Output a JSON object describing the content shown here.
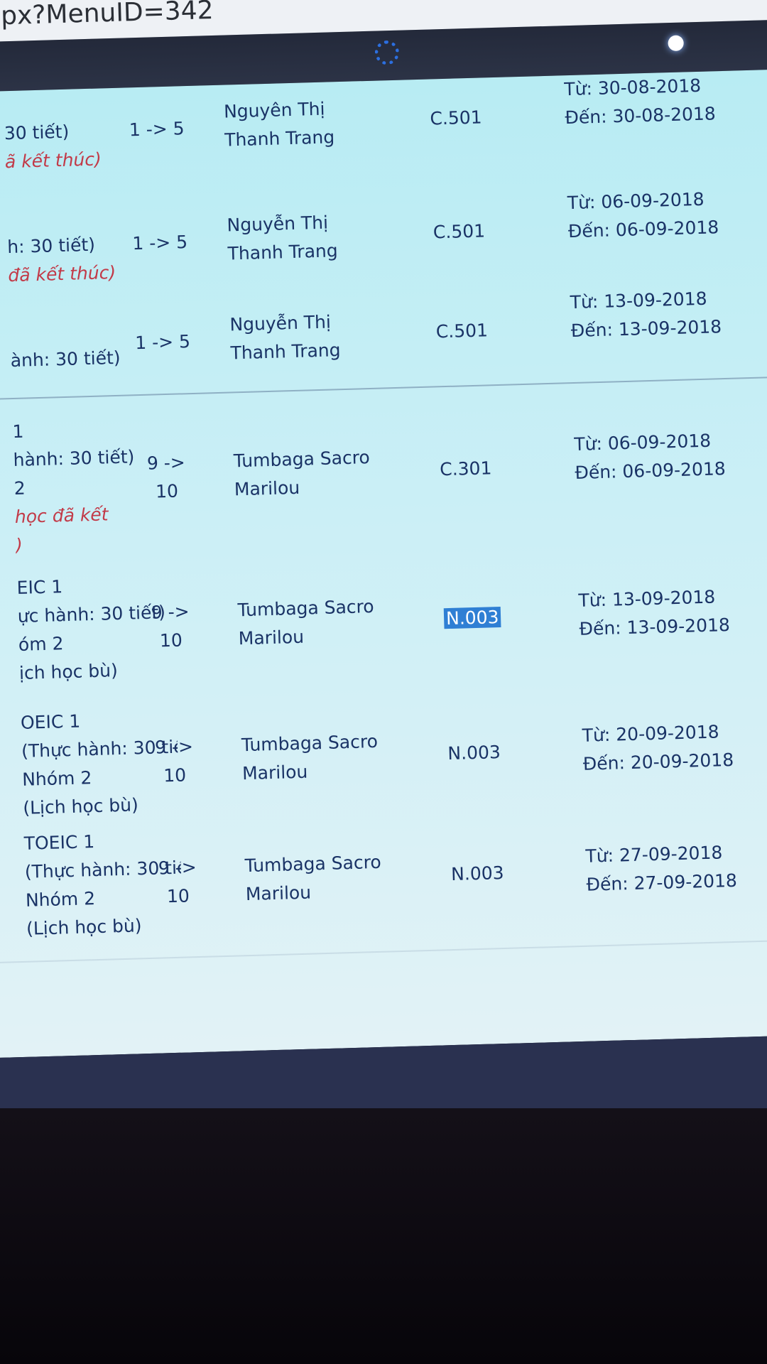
{
  "url": "px?MenuID=342",
  "rows": [
    {
      "subject": [
        "30 tiết)"
      ],
      "note": "ã kết thúc)",
      "period": [
        "1 -> 5"
      ],
      "teacher": [
        "Nguyên Thị",
        "Thanh Trang"
      ],
      "room": "C.501",
      "from": "Từ:   30-08-2018",
      "to": "Đến: 30-08-2018"
    },
    {
      "subject": [
        "h: 30 tiết)"
      ],
      "note": "đã kết thúc)",
      "period": [
        "1 -> 5"
      ],
      "teacher": [
        "Nguyễn Thị",
        "Thanh Trang"
      ],
      "room": "C.501",
      "from": "Từ:   06-09-2018",
      "to": "Đến: 06-09-2018"
    },
    {
      "subject": [
        "ành: 30 tiết)"
      ],
      "note": "",
      "period": [
        "1 -> 5"
      ],
      "teacher": [
        "Nguyễn Thị",
        "Thanh Trang"
      ],
      "room": "C.501",
      "from": "Từ:   13-09-2018",
      "to": "Đến: 13-09-2018"
    },
    {
      "subject": [
        "1",
        "hành: 30 tiết)",
        "2"
      ],
      "note": "học đã kết",
      "note2": ")",
      "period": [
        "9 ->",
        "10"
      ],
      "teacher": [
        "Tumbaga Sacro",
        "Marilou"
      ],
      "room": "C.301",
      "from": "Từ:   06-09-2018",
      "to": "Đến: 06-09-2018"
    },
    {
      "subject": [
        "EIC 1",
        "ực hành: 30 tiết)",
        "óm 2",
        "ịch học bù)"
      ],
      "note": "",
      "period": [
        "9 ->",
        "10"
      ],
      "teacher": [
        "Tumbaga Sacro",
        "Marilou"
      ],
      "room": "N.003",
      "room_highlight": true,
      "from": "Từ:   13-09-2018",
      "to": "Đến: 13-09-2018"
    },
    {
      "subject": [
        "OEIC 1",
        "(Thực hành: 30 tiết)",
        "Nhóm 2",
        "(Lịch học bù)"
      ],
      "note": "",
      "period": [
        "9 ->",
        "10"
      ],
      "teacher": [
        "Tumbaga Sacro",
        "Marilou"
      ],
      "room": "N.003",
      "from": "Từ:   20-09-2018",
      "to": "Đến: 20-09-2018"
    },
    {
      "subject": [
        "TOEIC 1",
        "(Thực hành: 30 tiết)",
        "Nhóm 2",
        "(Lịch học bù)"
      ],
      "note": "",
      "period": [
        "9 ->",
        "10"
      ],
      "teacher": [
        "Tumbaga Sacro",
        "Marilou"
      ],
      "room": "N.003",
      "from": "Từ:   27-09-2018",
      "to": "Đến: 27-09-2018"
    }
  ],
  "colors": {
    "text": "#1a3366",
    "note": "#c23a48",
    "highlight": "#2f7fd4",
    "content_bg": "#bfeef5"
  }
}
